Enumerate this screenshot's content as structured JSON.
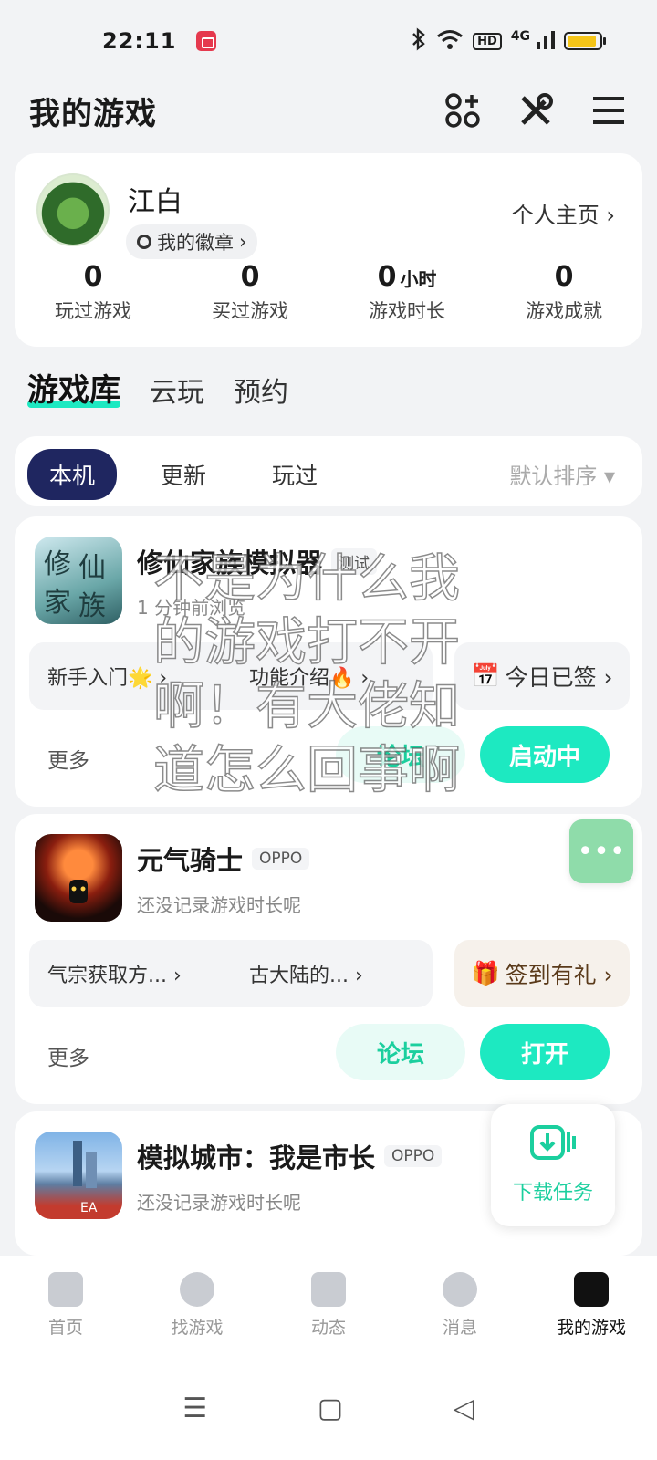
{
  "status_bar": {
    "time": "22:11",
    "network": "4G",
    "hd": "HD",
    "battery_level": 0.9
  },
  "header": {
    "title": "我的游戏"
  },
  "profile": {
    "name": "江白",
    "badge_label": "我的徽章",
    "homepage_link": "个人主页 ›",
    "stats": [
      {
        "value": "0",
        "unit": "",
        "label": "玩过游戏"
      },
      {
        "value": "0",
        "unit": "",
        "label": "买过游戏"
      },
      {
        "value": "0",
        "unit": "小时",
        "label": "游戏时长"
      },
      {
        "value": "0",
        "unit": "",
        "label": "游戏成就"
      }
    ]
  },
  "library_tabs": [
    {
      "label": "游戏库",
      "active": true
    },
    {
      "label": "云玩",
      "active": false
    },
    {
      "label": "预约",
      "active": false
    }
  ],
  "filter": {
    "chips": [
      {
        "label": "本机",
        "active": true
      },
      {
        "label": "更新",
        "active": false
      },
      {
        "label": "玩过",
        "active": false
      }
    ],
    "sort_label": "默认排序 ▾"
  },
  "games": [
    {
      "name": "修仙家族模拟器",
      "tag": "测试",
      "subtitle": "1 分钟前浏览",
      "links": [
        "新手入门🌟 ›",
        "功能介绍🔥 ›"
      ],
      "sign_label": "今日已签 ›",
      "more_label": "更多",
      "forum_label": "论坛",
      "action_label": "启动中"
    },
    {
      "name": "元气骑士",
      "tag": "OPPO",
      "subtitle": "还没记录游戏时长呢",
      "links": [
        "气宗获取方... ›",
        "古大陆的... ›"
      ],
      "sign_label": "签到有礼 ›",
      "more_label": "更多",
      "forum_label": "论坛",
      "action_label": "打开"
    },
    {
      "name": "模拟城市：我是市长",
      "tag": "OPPO",
      "subtitle": "还没记录游戏时长呢"
    }
  ],
  "floating": {
    "chat_label": "•••",
    "download_label": "下载任务"
  },
  "overlay_text": "不是为什么我的游戏打不开啊！有大佬知道怎么回事啊",
  "bottom_nav": [
    {
      "label": "首页",
      "active": false
    },
    {
      "label": "找游戏",
      "active": false
    },
    {
      "label": "动态",
      "active": false
    },
    {
      "label": "消息",
      "active": false
    },
    {
      "label": "我的游戏",
      "active": true
    }
  ],
  "system_nav": {
    "menu": "☰",
    "home": "▢",
    "back": "◁"
  }
}
